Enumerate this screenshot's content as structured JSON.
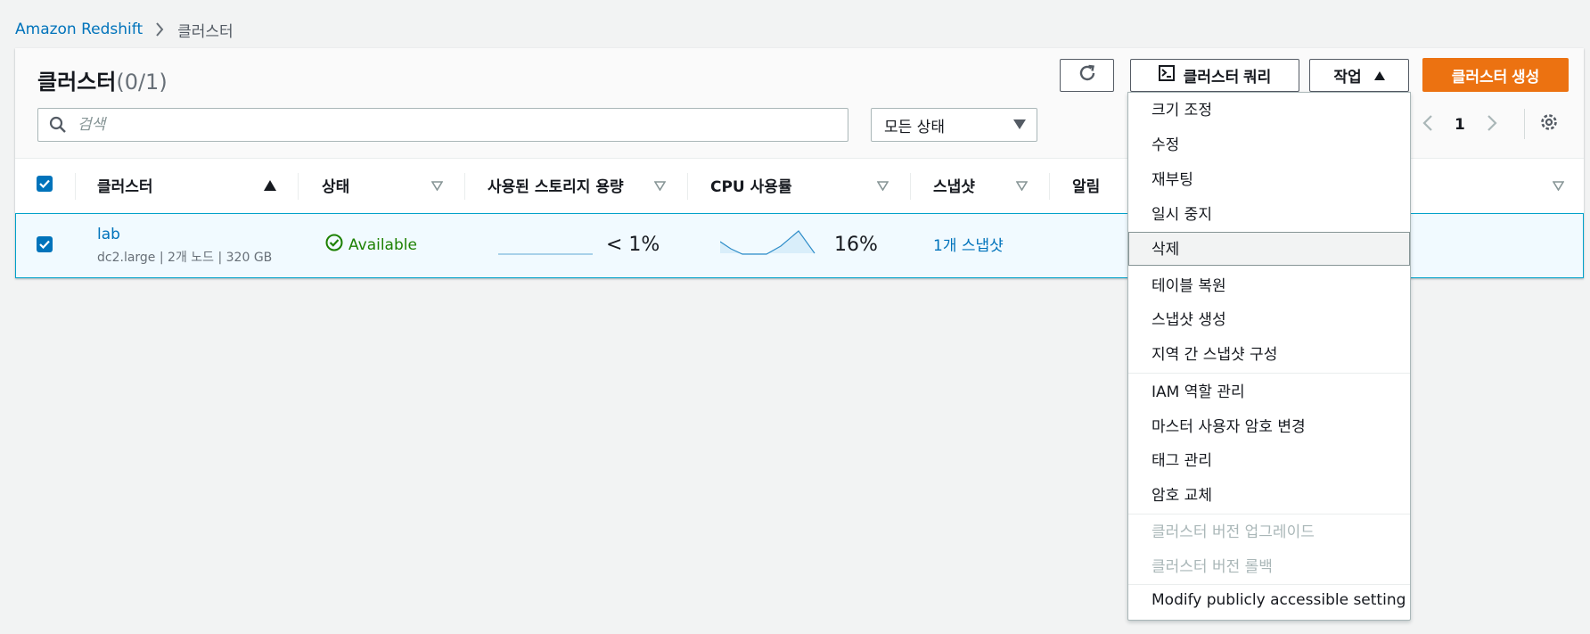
{
  "breadcrumb": {
    "root": "Amazon Redshift",
    "current": "클러스터"
  },
  "header": {
    "title": "클러스터",
    "count": "(0/1)",
    "query_label": "클러스터 쿼리",
    "actions_label": "작업",
    "create_label": "클러스터 생성"
  },
  "search": {
    "placeholder": "검색",
    "value": ""
  },
  "filter": {
    "selected": "모든 상태"
  },
  "pagination": {
    "page": "1"
  },
  "table": {
    "columns": [
      "클러스터",
      "상태",
      "사용된 스토리지 용량",
      "CPU 사용률",
      "스냅샷",
      "알림"
    ],
    "rows": [
      {
        "name": "lab",
        "detail": "dc2.large | 2개 노드 | 320 GB",
        "status": "Available",
        "storage": "< 1%",
        "storage_fraction": 0.005,
        "cpu": "16%",
        "snapshots": "1개 스냅샷",
        "selected": true
      }
    ]
  },
  "actions_menu": {
    "group1": [
      "크기 조정",
      "수정",
      "재부팅",
      "일시 중지",
      "삭제",
      "테이블 복원",
      "스냅샷 생성",
      "지역 간 스냅샷 구성"
    ],
    "group2": [
      "IAM 역할 관리",
      "마스터 사용자 암호 변경",
      "태그 관리",
      "암호 교체"
    ],
    "group3_disabled": [
      "클러스터 버전 업그레이드",
      "클러스터 버전 롤백"
    ],
    "group4": [
      "Modify publicly accessible setting"
    ],
    "highlighted": "삭제"
  },
  "colors": {
    "primary": "#ec7211",
    "link": "#0073bb",
    "success": "#1d8102",
    "selection_border": "#00a1c9",
    "selection_bg": "#f1faff"
  },
  "icons": [
    "chevron-right-icon",
    "refresh-icon",
    "terminal-icon",
    "caret-up-icon",
    "search-icon",
    "caret-down-icon",
    "chevron-left-icon",
    "gear-icon",
    "sort-asc-icon",
    "sort-icon",
    "check-circle-icon",
    "checkbox-checked-icon"
  ]
}
